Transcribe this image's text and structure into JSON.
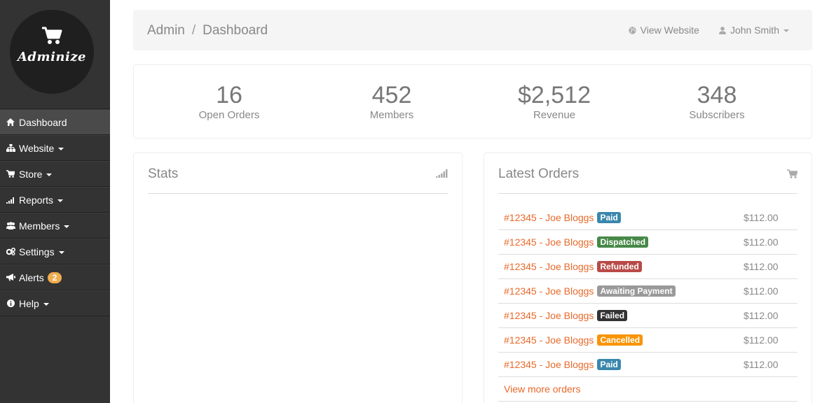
{
  "brand": {
    "name": "Adminize"
  },
  "sidebar": {
    "items": [
      {
        "label": "Dashboard",
        "icon": "home-icon",
        "active": true,
        "caret": false
      },
      {
        "label": "Website",
        "icon": "sitemap-icon",
        "caret": true
      },
      {
        "label": "Store",
        "icon": "cart-icon",
        "caret": true
      },
      {
        "label": "Reports",
        "icon": "signal-icon",
        "caret": true
      },
      {
        "label": "Members",
        "icon": "users-icon",
        "caret": true
      },
      {
        "label": "Settings",
        "icon": "cogs-icon",
        "caret": true
      },
      {
        "label": "Alerts",
        "icon": "bullhorn-icon",
        "caret": false,
        "badge": "2"
      },
      {
        "label": "Help",
        "icon": "info-icon",
        "caret": true
      }
    ]
  },
  "header": {
    "breadcrumb": [
      "Admin",
      "Dashboard"
    ],
    "breadcrumb_sep": "/",
    "view_website": "View Website",
    "user_name": "John Smith"
  },
  "tiles": [
    {
      "value": "16",
      "label": "Open Orders"
    },
    {
      "value": "452",
      "label": "Members"
    },
    {
      "value": "$2,512",
      "label": "Revenue"
    },
    {
      "value": "348",
      "label": "Subscribers"
    }
  ],
  "stats_panel": {
    "title": "Stats"
  },
  "orders_panel": {
    "title": "Latest Orders",
    "orders": [
      {
        "link": "#12345 - Joe Bloggs",
        "status": "Paid",
        "status_color": "#3a87ad",
        "amount": "$112.00"
      },
      {
        "link": "#12345 - Joe Bloggs",
        "status": "Dispatched",
        "status_color": "#468847",
        "amount": "$112.00"
      },
      {
        "link": "#12345 - Joe Bloggs",
        "status": "Refunded",
        "status_color": "#b94a48",
        "amount": "$112.00"
      },
      {
        "link": "#12345 - Joe Bloggs",
        "status": "Awaiting Payment",
        "status_color": "#999999",
        "amount": "$112.00"
      },
      {
        "link": "#12345 - Joe Bloggs",
        "status": "Failed",
        "status_color": "#333333",
        "amount": "$112.00"
      },
      {
        "link": "#12345 - Joe Bloggs",
        "status": "Cancelled",
        "status_color": "#f89406",
        "amount": "$112.00"
      },
      {
        "link": "#12345 - Joe Bloggs",
        "status": "Paid",
        "status_color": "#3a87ad",
        "amount": "$112.00"
      }
    ],
    "view_more": "View more orders"
  },
  "colors": {
    "accent": "#e8692b",
    "sidebar_bg": "#333333",
    "badge": "#f0ad4e"
  }
}
